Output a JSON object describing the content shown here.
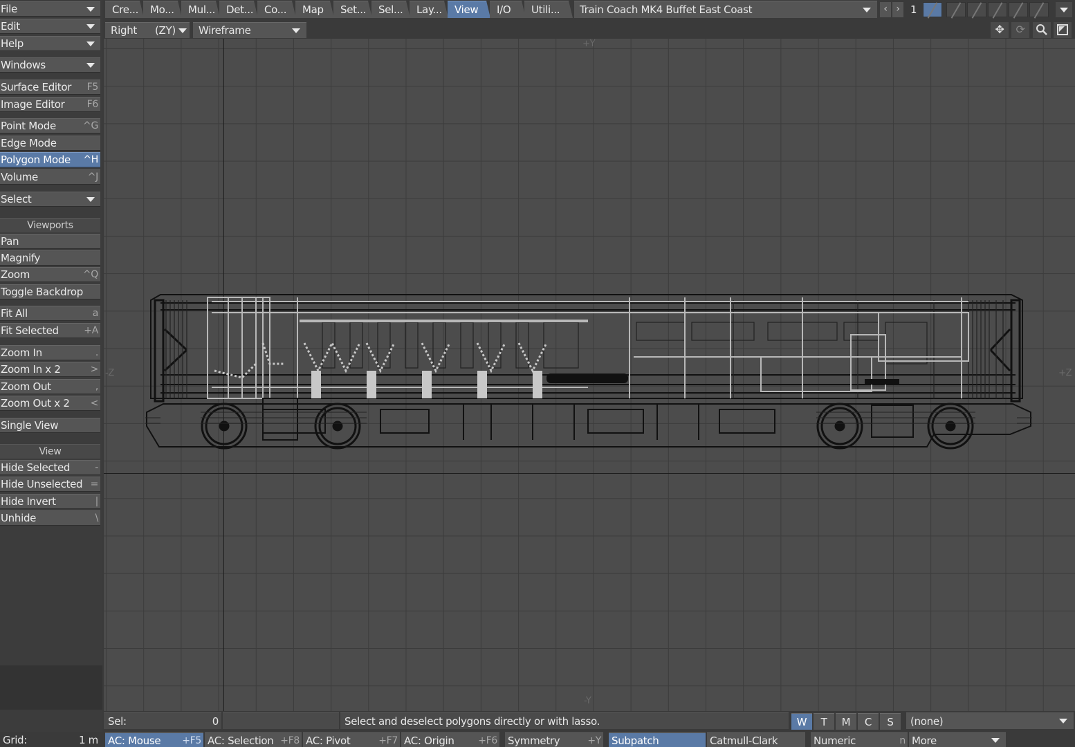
{
  "sidebar": {
    "file": "File",
    "edit": "Edit",
    "help": "Help",
    "windows": "Windows",
    "surface_editor": {
      "label": "Surface Editor",
      "shortcut": "F5"
    },
    "image_editor": {
      "label": "Image Editor",
      "shortcut": "F6"
    },
    "point_mode": {
      "label": "Point Mode",
      "shortcut": "^G"
    },
    "edge_mode": {
      "label": "Edge Mode",
      "shortcut": ""
    },
    "polygon_mode": {
      "label": "Polygon Mode",
      "shortcut": "^H"
    },
    "volume": {
      "label": "Volume",
      "shortcut": "^J"
    },
    "select": "Select",
    "viewports_heading": "Viewports",
    "pan": {
      "label": "Pan",
      "shortcut": ""
    },
    "magnify": {
      "label": "Magnify",
      "shortcut": ""
    },
    "zoom": {
      "label": "Zoom",
      "shortcut": "^Q"
    },
    "toggle_backdrop": {
      "label": "Toggle Backdrop",
      "shortcut": ""
    },
    "fit_all": {
      "label": "Fit All",
      "shortcut": "a"
    },
    "fit_selected": {
      "label": "Fit Selected",
      "shortcut": "+A"
    },
    "zoom_in": {
      "label": "Zoom In",
      "shortcut": "."
    },
    "zoom_in_x2": {
      "label": "Zoom In x 2",
      "shortcut": ">"
    },
    "zoom_out": {
      "label": "Zoom Out",
      "shortcut": ","
    },
    "zoom_out_x2": {
      "label": "Zoom Out x 2",
      "shortcut": "<"
    },
    "single_view": {
      "label": "Single View",
      "shortcut": ""
    },
    "view_heading": "View",
    "hide_selected": {
      "label": "Hide Selected",
      "shortcut": "-"
    },
    "hide_unselected": {
      "label": "Hide Unselected",
      "shortcut": "="
    },
    "hide_invert": {
      "label": "Hide Invert",
      "shortcut": "|"
    },
    "unhide": {
      "label": "Unhide",
      "shortcut": "\\"
    }
  },
  "tabs": [
    "Cre...",
    "Mo...",
    "Mul...",
    "Det...",
    "Co...",
    "Map",
    "Set...",
    "Sel...",
    "Lay...",
    "View",
    "I/O",
    "Utili..."
  ],
  "active_tab": "View",
  "object_name": "Train Coach MK4 Buffet East Coast",
  "layer_number": "1",
  "viewport": {
    "view": "Right",
    "axes": "(ZY)",
    "render_mode": "Wireframe",
    "axis_labels": {
      "top": "+Y",
      "bottom": "-Y",
      "left": "-Z",
      "right": "+Z"
    }
  },
  "status": {
    "sel_label": "Sel:",
    "sel_count": "0",
    "message": "Select and deselect polygons directly or with lasso.",
    "wtmcs": [
      "W",
      "T",
      "M",
      "C",
      "S"
    ],
    "wtmcs_active": "W",
    "none_select": "(none)"
  },
  "bottom_bar": {
    "grid_label": "Grid:",
    "grid_value": "1 m",
    "ac_mouse": {
      "label": "AC: Mouse",
      "shortcut": "+F5"
    },
    "ac_selection": {
      "label": "AC: Selection",
      "shortcut": "+F8"
    },
    "ac_pivot": {
      "label": "AC: Pivot",
      "shortcut": "+F7"
    },
    "ac_origin": {
      "label": "AC: Origin",
      "shortcut": "+F6"
    },
    "symmetry": {
      "label": "Symmetry",
      "shortcut": "+Y"
    },
    "subpatch": "Subpatch",
    "catmull_clark": "Catmull-Clark",
    "numeric": {
      "label": "Numeric",
      "shortcut": "n"
    },
    "more": "More"
  },
  "colors": {
    "accent": "#5a7aa6",
    "panel": "#555555",
    "background": "#3a3a3a",
    "viewport": "#4c4c4c"
  }
}
